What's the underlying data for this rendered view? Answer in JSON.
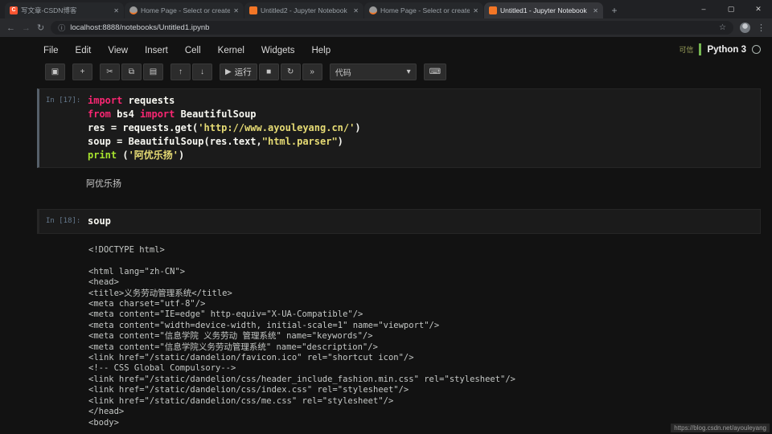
{
  "browser": {
    "tabs": [
      {
        "title": "写文章-CSDN博客",
        "favicon": "csdn",
        "active": false
      },
      {
        "title": "Home Page - Select or create",
        "favicon": "jupyter-home",
        "active": false
      },
      {
        "title": "Untitled2 - Jupyter Notebook",
        "favicon": "jupyter-nb",
        "active": false
      },
      {
        "title": "Home Page - Select or create",
        "favicon": "jupyter-home",
        "active": false
      },
      {
        "title": "Untitled1 - Jupyter Notebook",
        "favicon": "jupyter-nb",
        "active": true
      }
    ],
    "url": "localhost:8888/notebooks/Untitled1.ipynb"
  },
  "icons": {
    "back": "←",
    "forward": "→",
    "refresh": "↻",
    "info": "ⓘ",
    "star": "☆",
    "menu_dots": "⋮",
    "minimize": "–",
    "maximize": "▢",
    "close": "✕",
    "new_tab": "+",
    "keyboard": "⌨",
    "dropdown": "▾"
  },
  "menubar": {
    "items": [
      "File",
      "Edit",
      "View",
      "Insert",
      "Cell",
      "Kernel",
      "Widgets",
      "Help"
    ],
    "trusted_label": "可信",
    "kernel_name": "Python 3"
  },
  "toolbar": {
    "buttons": [
      {
        "name": "save",
        "glyph": "▣",
        "gap": false
      },
      {
        "name": "add-cell",
        "glyph": "+",
        "gap": true
      },
      {
        "name": "cut-cell",
        "glyph": "✂",
        "gap": true
      },
      {
        "name": "copy-cell",
        "glyph": "⧉",
        "gap": false
      },
      {
        "name": "paste-cell",
        "glyph": "▤",
        "gap": false
      },
      {
        "name": "move-cell-up",
        "glyph": "↑",
        "gap": true
      },
      {
        "name": "move-cell-down",
        "glyph": "↓",
        "gap": false
      },
      {
        "name": "run",
        "glyph": "▶",
        "label": "运行",
        "gap": true
      },
      {
        "name": "interrupt-kernel",
        "glyph": "■",
        "gap": false
      },
      {
        "name": "restart-kernel",
        "glyph": "↻",
        "gap": false
      },
      {
        "name": "restart-run-all",
        "glyph": "»",
        "gap": false
      }
    ],
    "cell_type_value": "代码"
  },
  "notebook": {
    "cells": [
      {
        "prompt": "In [17]:",
        "code_lines": [
          [
            {
              "c": "kw",
              "t": "import"
            },
            {
              "c": "pl",
              "t": " requests"
            }
          ],
          [
            {
              "c": "kw",
              "t": "from"
            },
            {
              "c": "pl",
              "t": " bs4 "
            },
            {
              "c": "kw",
              "t": "import"
            },
            {
              "c": "pl",
              "t": " BeautifulSoup"
            }
          ],
          [
            {
              "c": "pl",
              "t": "res = requests.get("
            },
            {
              "c": "str",
              "t": "'http://www.ayouleyang.cn/'"
            },
            {
              "c": "pl",
              "t": ")"
            }
          ],
          [
            {
              "c": "pl",
              "t": "soup = BeautifulSoup(res.text,"
            },
            {
              "c": "str",
              "t": "\"html.parser\""
            },
            {
              "c": "pl",
              "t": ")"
            }
          ],
          [
            {
              "c": "fn",
              "t": "print"
            },
            {
              "c": "pl",
              "t": " ("
            },
            {
              "c": "str",
              "t": "'阿优乐扬'"
            },
            {
              "c": "pl",
              "t": ")"
            }
          ]
        ],
        "output": "阿优乐扬"
      },
      {
        "prompt": "In [18]:",
        "code_lines": [
          [
            {
              "c": "pl",
              "t": "soup"
            }
          ]
        ],
        "output_lines": [
          "<!DOCTYPE html>",
          "",
          "<html lang=\"zh-CN\">",
          "<head>",
          "<title>义务劳动管理系统</title>",
          "<meta charset=\"utf-8\"/>",
          "<meta content=\"IE=edge\" http-equiv=\"X-UA-Compatible\"/>",
          "<meta content=\"width=device-width, initial-scale=1\" name=\"viewport\"/>",
          "<meta content=\"信息学院 义务劳动 管理系统\" name=\"keywords\"/>",
          "<meta content=\"信息学院义务劳动管理系统\" name=\"description\"/>",
          "<link href=\"/static/dandelion/favicon.ico\" rel=\"shortcut icon\"/>",
          "<!-- CSS Global Compulsory-->",
          "<link href=\"/static/dandelion/css/header_include_fashion.min.css\" rel=\"stylesheet\"/>",
          "<link href=\"/static/dandelion/css/index.css\" rel=\"stylesheet\"/>",
          "<link href=\"/static/dandelion/css/me.css\" rel=\"stylesheet\"/>",
          "</head>",
          "<body>"
        ]
      }
    ]
  },
  "watermark": "https://blog.csdn.net/ayouleyang"
}
